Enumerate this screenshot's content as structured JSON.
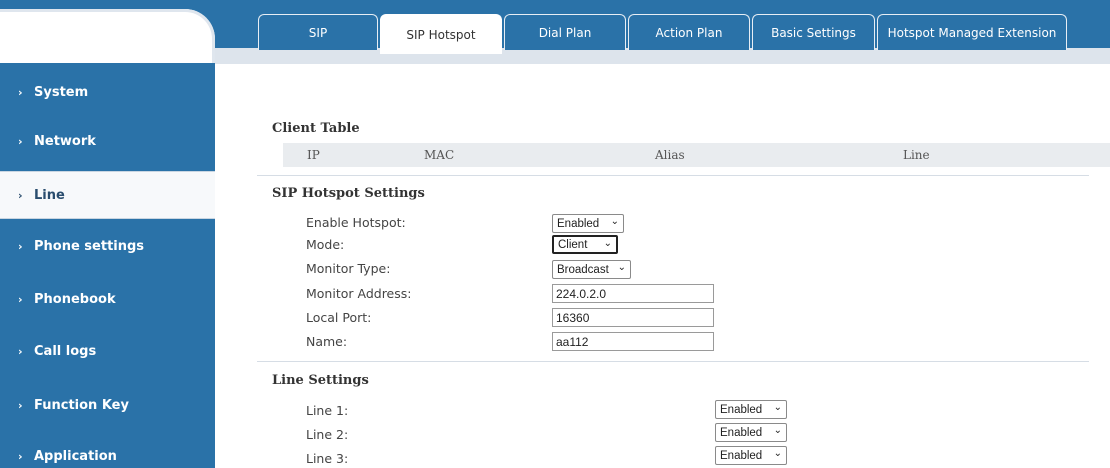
{
  "sidebar": {
    "items": [
      {
        "label": "System"
      },
      {
        "label": "Network"
      },
      {
        "label": "Line"
      },
      {
        "label": "Phone settings"
      },
      {
        "label": "Phonebook"
      },
      {
        "label": "Call logs"
      },
      {
        "label": "Function Key"
      },
      {
        "label": "Application"
      }
    ],
    "active": "Line"
  },
  "tabs": [
    {
      "label": "SIP"
    },
    {
      "label": "SIP Hotspot"
    },
    {
      "label": "Dial Plan"
    },
    {
      "label": "Action Plan"
    },
    {
      "label": "Basic Settings"
    },
    {
      "label": "Hotspot Managed Extension"
    }
  ],
  "active_tab": "SIP Hotspot",
  "client_table": {
    "title": "Client Table",
    "columns": [
      "IP",
      "MAC",
      "Alias",
      "Line"
    ]
  },
  "hotspot_settings": {
    "title": "SIP Hotspot Settings",
    "fields": [
      {
        "label": "Enable Hotspot:",
        "value": "Enabled"
      },
      {
        "label": "Mode:",
        "value": "Client"
      },
      {
        "label": "Monitor Type:",
        "value": "Broadcast"
      },
      {
        "label": "Monitor Address:",
        "value": "224.0.2.0"
      },
      {
        "label": "Local Port:",
        "value": "16360"
      },
      {
        "label": "Name:",
        "value": "aa112"
      }
    ]
  },
  "line_settings": {
    "title": "Line Settings",
    "lines": [
      {
        "label": "Line 1:",
        "value": "Enabled"
      },
      {
        "label": "Line 2:",
        "value": "Enabled"
      },
      {
        "label": "Line 3:",
        "value": "Enabled"
      }
    ]
  },
  "icons": {
    "chevron": "chevron-right-icon",
    "caret": "chevron-down-icon"
  },
  "colors": {
    "brand_blue": "#2a72a8",
    "active_bg": "#f7f9fb"
  }
}
